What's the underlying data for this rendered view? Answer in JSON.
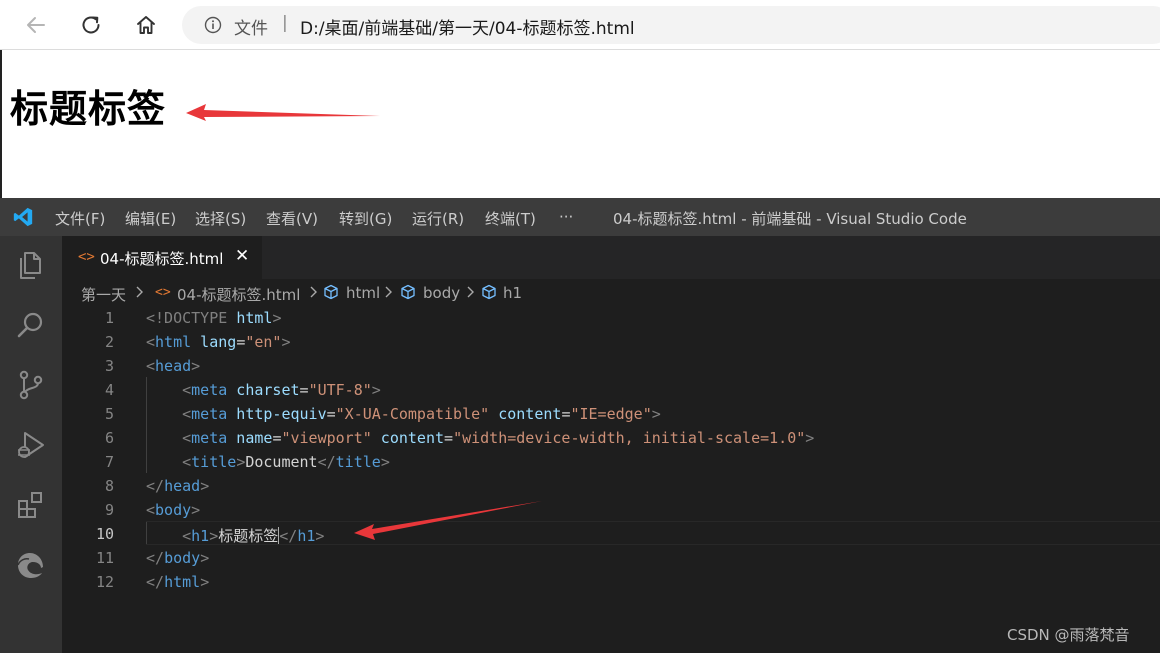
{
  "browser": {
    "address": {
      "file_label": "文件",
      "separator": "|",
      "url": "D:/桌面/前端基础/第一天/04-标题标签.html"
    },
    "page_heading": "标题标签"
  },
  "vscode": {
    "menu": [
      "文件(F)",
      "编辑(E)",
      "选择(S)",
      "查看(V)",
      "转到(G)",
      "运行(R)",
      "终端(T)",
      "···"
    ],
    "window_title": "04-标题标签.html - 前端基础 - Visual Studio Code",
    "tab": {
      "icon": "<>",
      "name": "04-标题标签.html",
      "close": "✕"
    },
    "breadcrumb": [
      "第一天",
      "04-标题标签.html",
      "html",
      "body",
      "h1"
    ],
    "line_numbers": [
      "1",
      "2",
      "3",
      "4",
      "5",
      "6",
      "7",
      "8",
      "9",
      "10",
      "11",
      "12"
    ],
    "active_line": "10",
    "code": {
      "l1": {
        "a": "<!DOCTYPE ",
        "b": "html",
        "c": ">"
      },
      "l2": {
        "a": "<",
        "b": "html",
        "c": " lang",
        "d": "=",
        "e": "\"en\"",
        "f": ">"
      },
      "l3": {
        "a": "<",
        "b": "head",
        "c": ">"
      },
      "l4": {
        "a": "<",
        "b": "meta",
        "c": " charset",
        "d": "=",
        "e": "\"UTF-8\"",
        "f": ">"
      },
      "l5": {
        "a": "<",
        "b": "meta",
        "c": " http-equiv",
        "d": "=",
        "e": "\"X-UA-Compatible\"",
        "f": " content",
        "g": "=",
        "h": "\"IE=edge\"",
        "i": ">"
      },
      "l6": {
        "a": "<",
        "b": "meta",
        "c": " name",
        "d": "=",
        "e": "\"viewport\"",
        "f": " content",
        "g": "=",
        "h": "\"width=device-width, initial-scale=1.0\"",
        "i": ">"
      },
      "l7": {
        "a": "<",
        "b": "title",
        "c": ">",
        "d": "Document",
        "e": "</",
        "f": "title",
        "g": ">"
      },
      "l8": {
        "a": "</",
        "b": "head",
        "c": ">"
      },
      "l9": {
        "a": "<",
        "b": "body",
        "c": ">"
      },
      "l10": {
        "a": "<",
        "b": "h1",
        "c": ">",
        "d": "标题标签",
        "e": "</",
        "f": "h1",
        "g": ">"
      },
      "l11": {
        "a": "</",
        "b": "body",
        "c": ">"
      },
      "l12": {
        "a": "</",
        "b": "html",
        "c": ">"
      }
    }
  },
  "watermark": "CSDN @雨落梵音",
  "colors": {
    "arrow": "#e8373a",
    "vscode_blue": "#23a9f2",
    "tag": "#569cd6",
    "attr": "#9cdcfe",
    "string": "#ce9178",
    "bracket": "#808080"
  }
}
